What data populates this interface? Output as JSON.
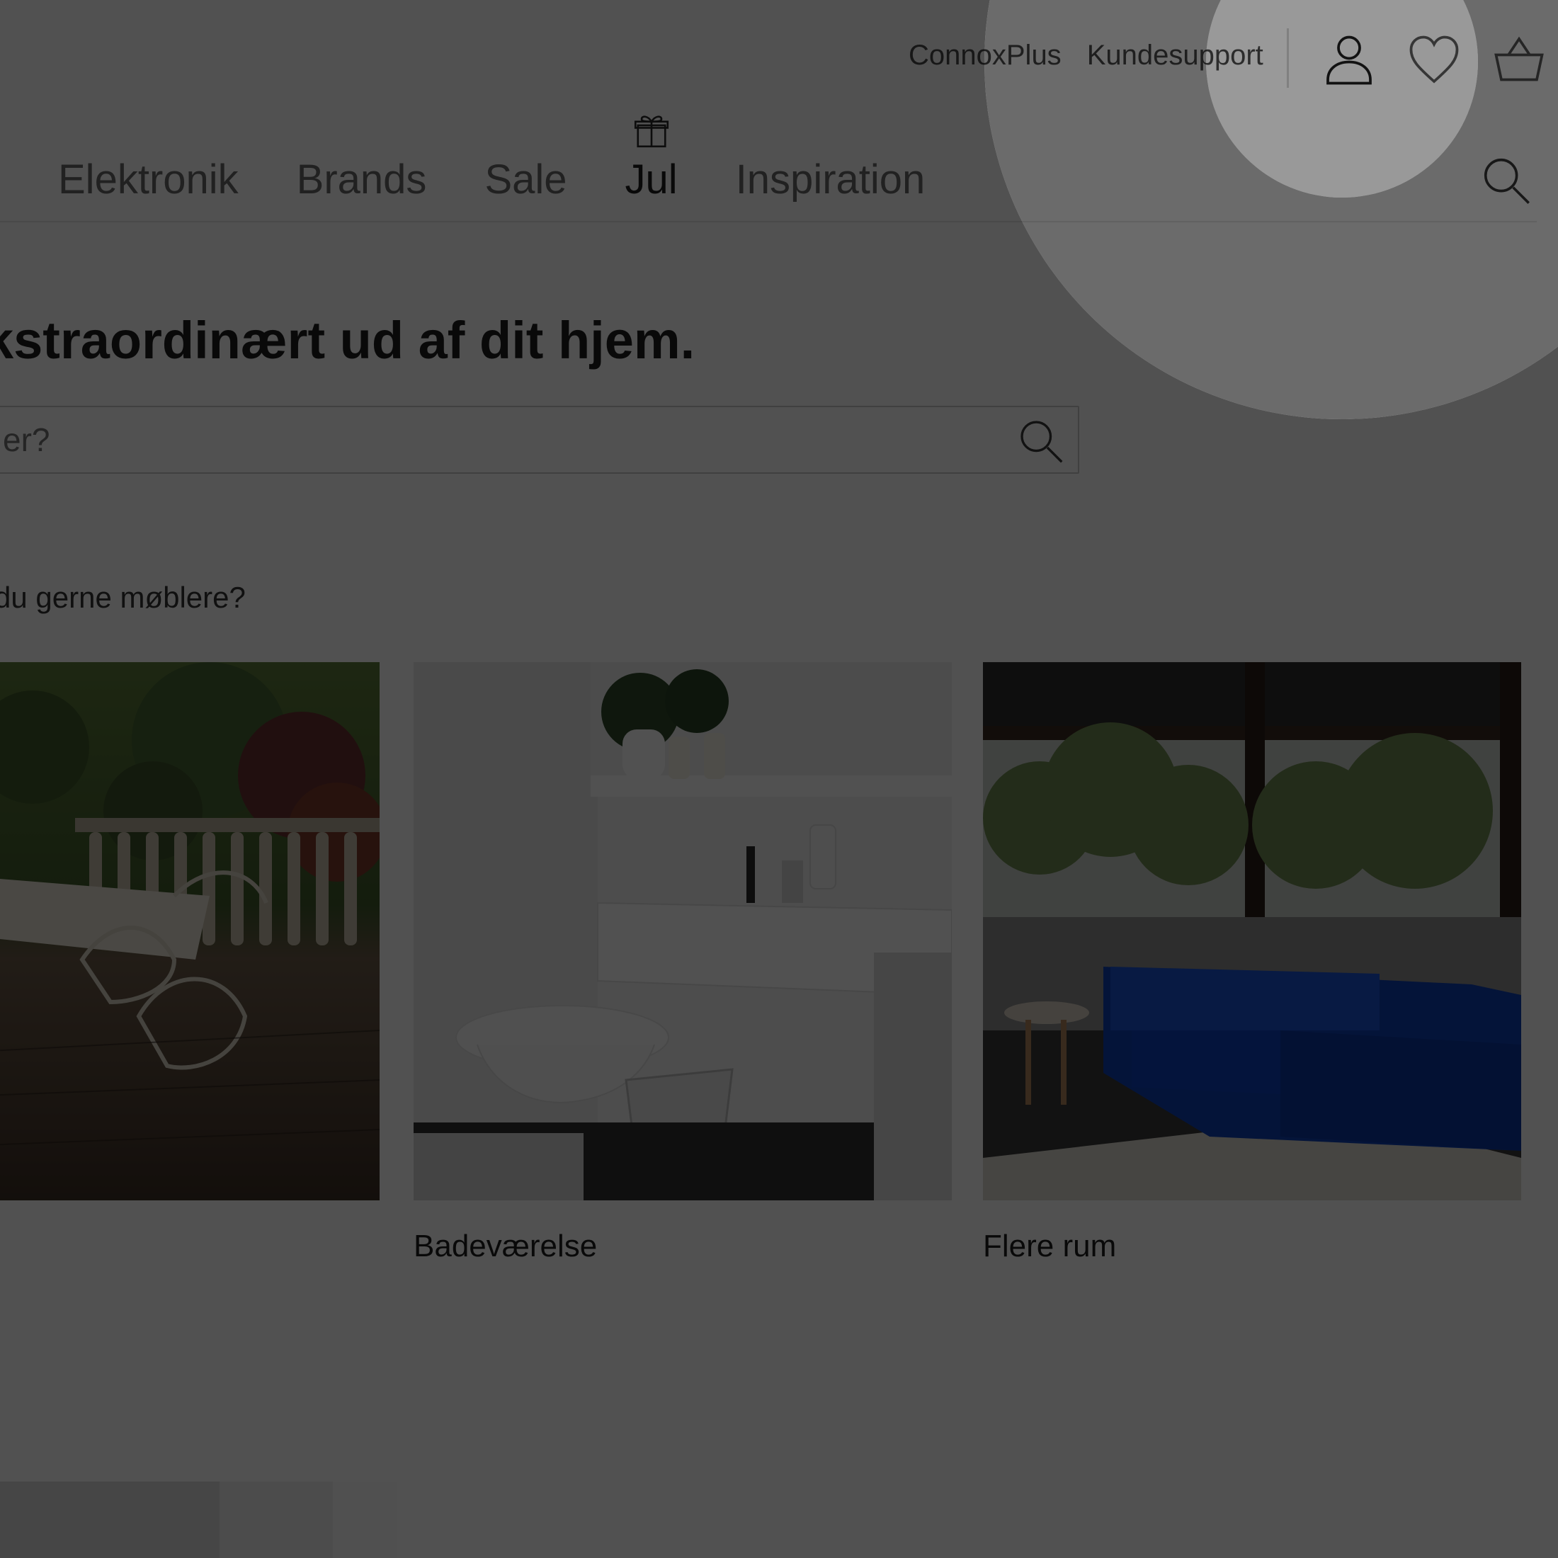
{
  "header": {
    "top_links": [
      "ConnoxPlus",
      "Kundesupport"
    ],
    "icons": {
      "account": "user-icon",
      "wishlist": "heart-icon",
      "basket": "basket-icon"
    }
  },
  "nav": {
    "items": [
      {
        "label": "Elektronik",
        "active": false
      },
      {
        "label": "Brands",
        "active": false
      },
      {
        "label": "Sale",
        "active": false
      },
      {
        "label": "Jul",
        "active": true,
        "icon": "gift-icon"
      },
      {
        "label": "Inspiration",
        "active": false
      }
    ],
    "search_icon": "search-icon"
  },
  "hero": {
    "title": "kstraordinært ud af dit hjem.",
    "search_placeholder": "er?",
    "search_icon": "search-icon"
  },
  "rooms": {
    "question": "du gerne møblere?",
    "cards": [
      {
        "label": ""
      },
      {
        "label": "Badeværelse"
      },
      {
        "label": "Flere rum"
      }
    ]
  },
  "colors": {
    "overlay": "#000000",
    "accent_blue": "#0d3fb5"
  }
}
